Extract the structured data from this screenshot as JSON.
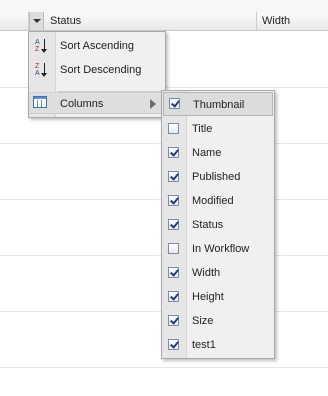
{
  "grid": {
    "columns": [
      {
        "label": "Status"
      },
      {
        "label": "Width"
      }
    ]
  },
  "menu": {
    "items": [
      {
        "label": "Sort Ascending",
        "icon": "sort-ascending-icon"
      },
      {
        "label": "Sort Descending",
        "icon": "sort-descending-icon"
      },
      {
        "label": "Columns",
        "icon": "columns-icon",
        "has_submenu": true,
        "active": true
      }
    ],
    "sort_glyphs": {
      "asc_top": "A",
      "asc_bottom": "Z",
      "desc_top": "Z",
      "desc_bottom": "A"
    }
  },
  "submenu": {
    "items": [
      {
        "label": "Thumbnail",
        "checked": true,
        "highlighted": true
      },
      {
        "label": "Title",
        "checked": false
      },
      {
        "label": "Name",
        "checked": true
      },
      {
        "label": "Published",
        "checked": true
      },
      {
        "label": "Modified",
        "checked": true
      },
      {
        "label": "Status",
        "checked": true
      },
      {
        "label": "In Workflow",
        "checked": false
      },
      {
        "label": "Width",
        "checked": true
      },
      {
        "label": "Height",
        "checked": true
      },
      {
        "label": "Size",
        "checked": true
      },
      {
        "label": "test1",
        "checked": true
      }
    ]
  },
  "colors": {
    "menu_bg": "#f0f0f0",
    "highlight": "#dcdcdc",
    "check": "#1f3f7a",
    "asc_letter": "#2b4a8f",
    "desc_letter": "#b3262a"
  }
}
